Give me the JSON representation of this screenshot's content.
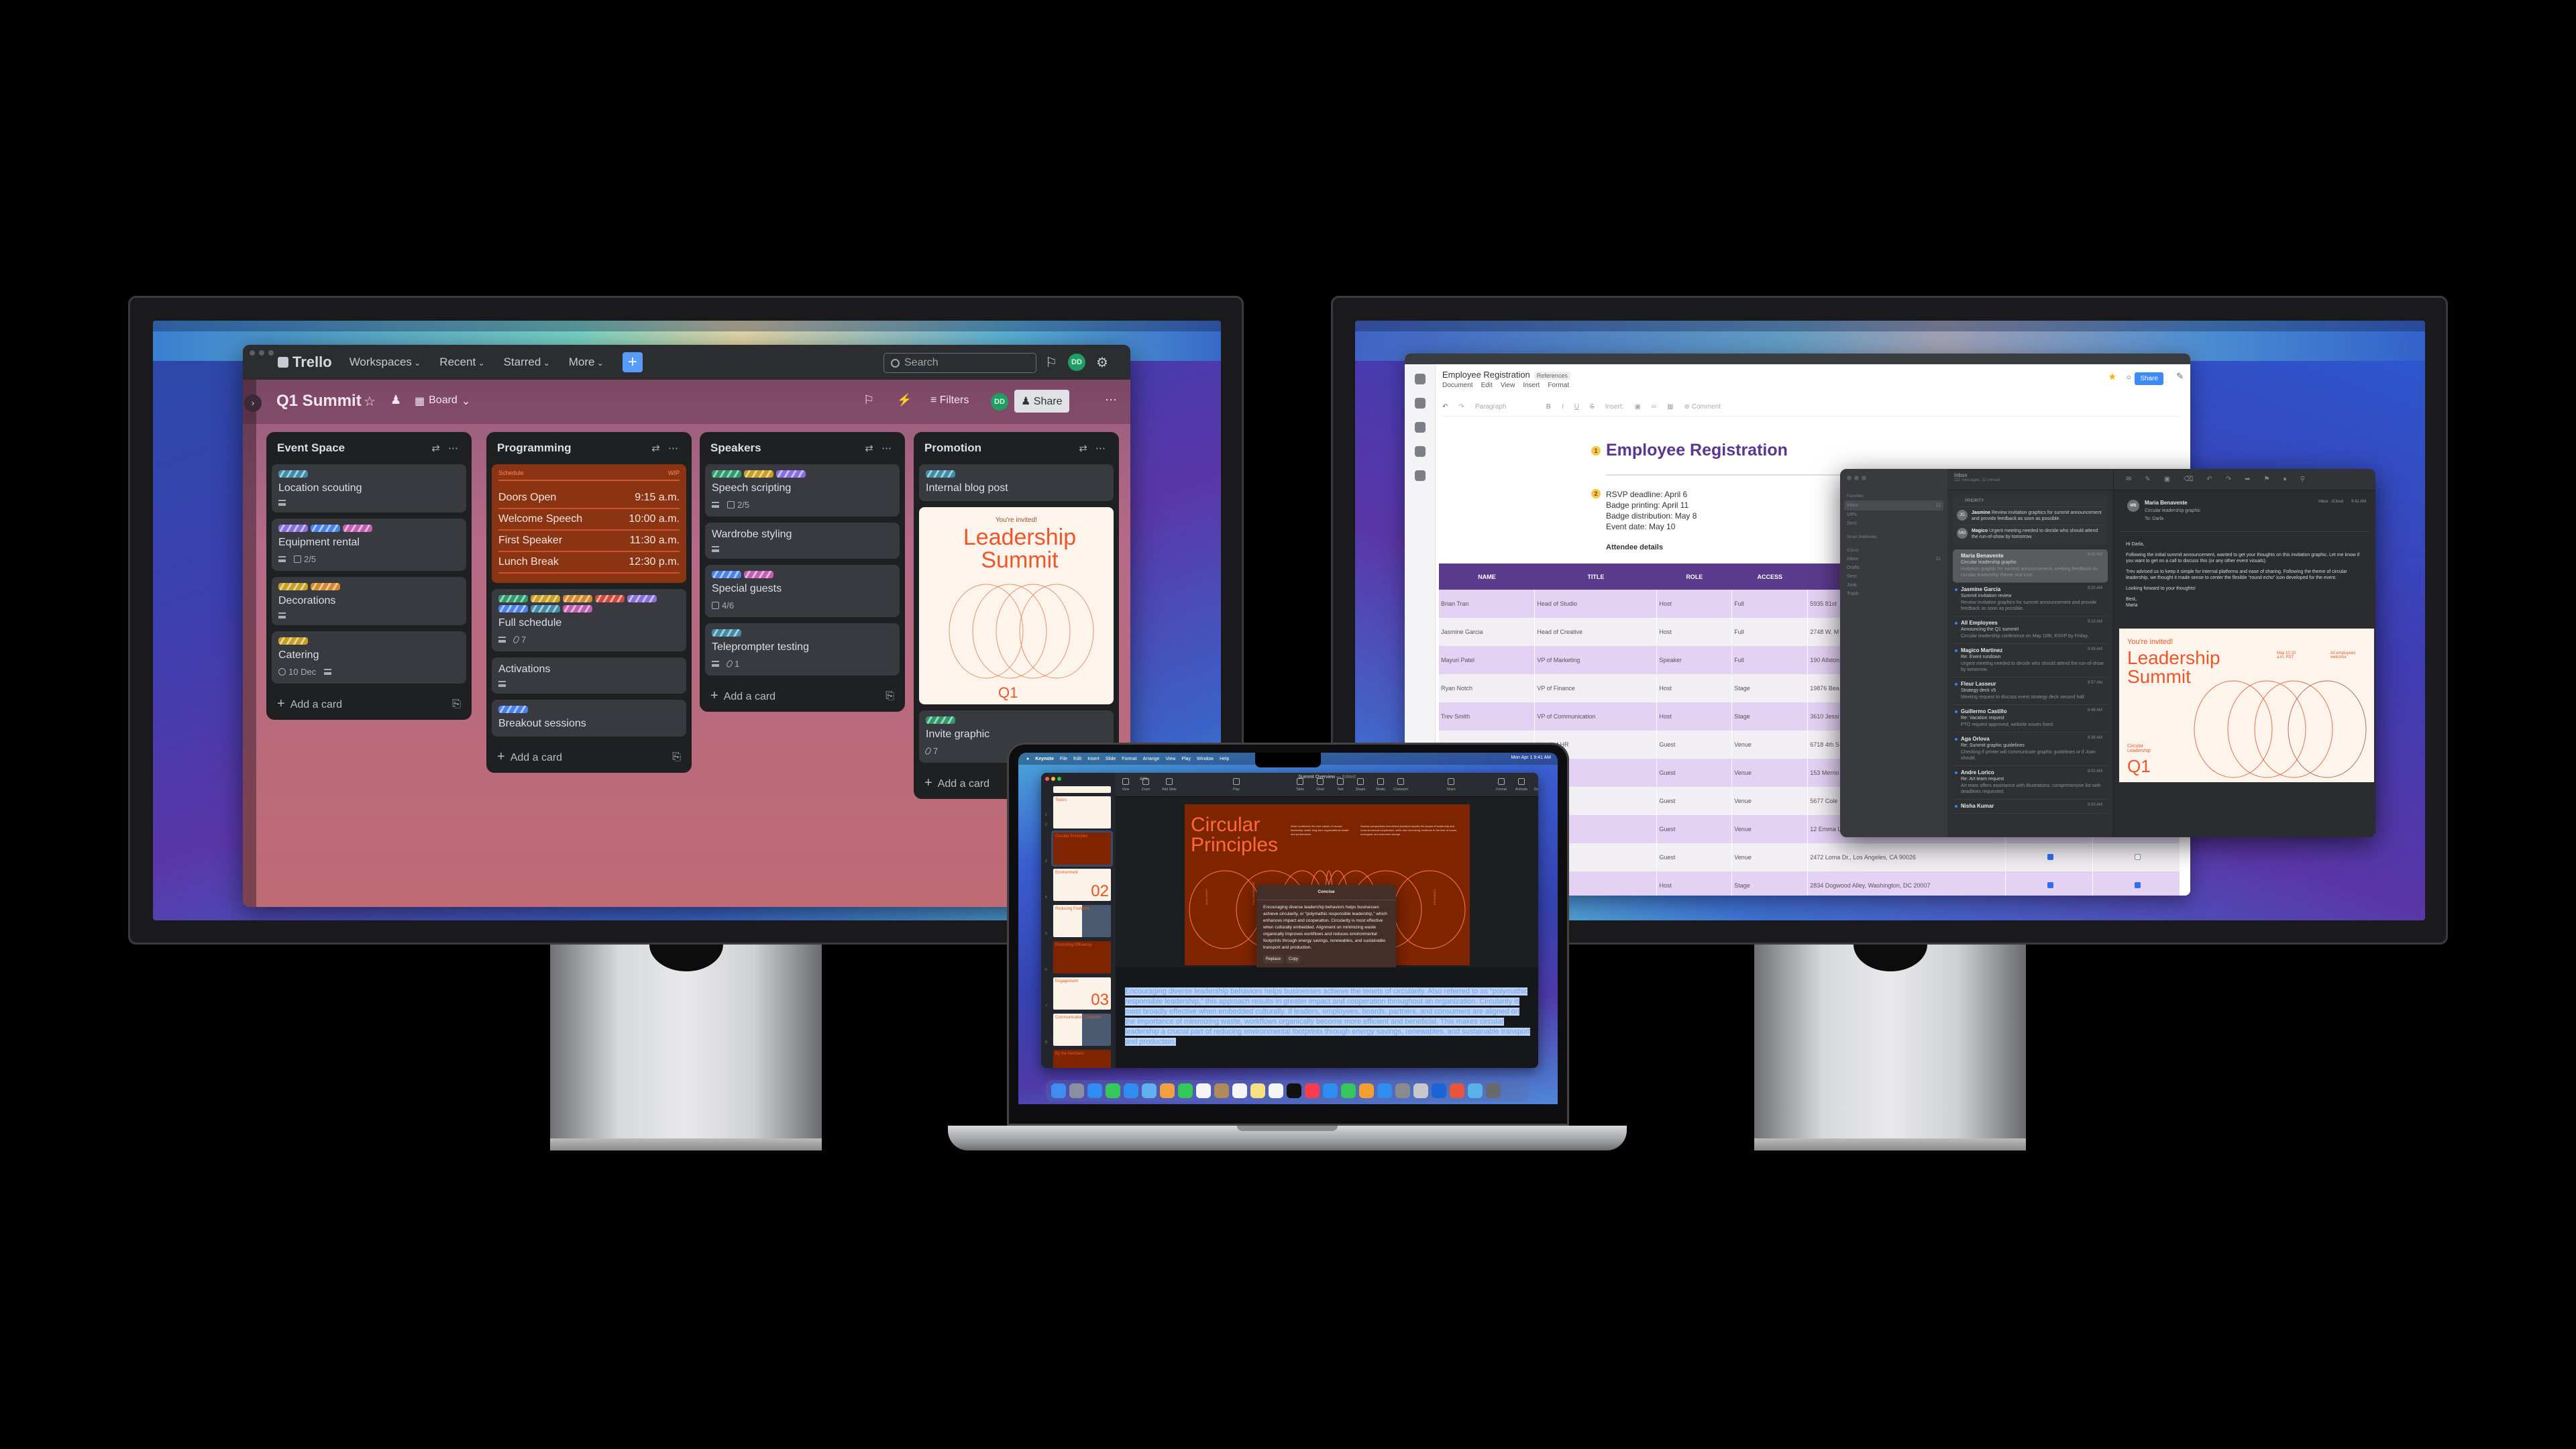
{
  "trello": {
    "logo": "Trello",
    "nav": [
      "Workspaces",
      "Recent",
      "Starred",
      "More"
    ],
    "create_label": "+",
    "search_placeholder": "Search",
    "avatar": "DD",
    "board_title": "Q1 Summit",
    "view_label": "Board",
    "filters_label": "Filters",
    "share_label": "Share",
    "add_card_label": "Add a card",
    "label_colors": {
      "teal": "#3f8ca8",
      "purple": "#8a6ee0",
      "blue": "#4a82ec",
      "pink": "#c05fb2",
      "yellow": "#c8a021",
      "orange": "#d3892b",
      "green": "#2c9a6a",
      "red": "#cf4a3c"
    },
    "lists": [
      {
        "title": "Event Space",
        "cards": [
          {
            "title": "Location scouting",
            "labels": [
              "teal"
            ],
            "badges": [
              {
                "icon": "description"
              }
            ]
          },
          {
            "title": "Equipment rental",
            "labels": [
              "purple",
              "blue",
              "pink"
            ],
            "badges": [
              {
                "icon": "description"
              },
              {
                "icon": "checklist",
                "text": "2/5"
              }
            ]
          },
          {
            "title": "Decorations",
            "labels": [
              "yellow",
              "orange"
            ],
            "badges": [
              {
                "icon": "description"
              }
            ]
          },
          {
            "title": "Catering",
            "labels": [
              "yellow"
            ],
            "badges": [
              {
                "icon": "clock",
                "text": "10 Dec"
              },
              {
                "icon": "description"
              }
            ]
          }
        ]
      },
      {
        "title": "Programming",
        "cards": [
          {
            "type": "schedule",
            "header": "Schedule",
            "tag": "WIP",
            "rows": [
              [
                "Doors Open",
                "9:15 a.m."
              ],
              [
                "Welcome Speech",
                "10:00 a.m."
              ],
              [
                "First Speaker",
                "11:30 a.m."
              ],
              [
                "Lunch Break",
                "12:30 p.m."
              ]
            ]
          },
          {
            "title": "Full schedule",
            "labels": [
              "green",
              "yellow",
              "orange",
              "red",
              "purple",
              "blue",
              "teal",
              "pink"
            ],
            "badges": [
              {
                "icon": "description"
              },
              {
                "icon": "attachment",
                "text": "7"
              }
            ]
          },
          {
            "title": "Activations",
            "labels": [],
            "badges": [
              {
                "icon": "description"
              }
            ]
          },
          {
            "title": "Breakout sessions",
            "labels": [
              "blue"
            ],
            "badges": []
          }
        ]
      },
      {
        "title": "Speakers",
        "cards": [
          {
            "title": "Speech scripting",
            "labels": [
              "green",
              "yellow",
              "purple"
            ],
            "badges": [
              {
                "icon": "description"
              },
              {
                "icon": "checklist",
                "text": "2/5"
              }
            ]
          },
          {
            "title": "Wardrobe styling",
            "labels": [],
            "badges": [
              {
                "icon": "description"
              }
            ]
          },
          {
            "title": "Special guests",
            "labels": [
              "blue",
              "pink"
            ],
            "badges": [
              {
                "icon": "checklist",
                "text": "4/6"
              }
            ]
          },
          {
            "title": "Teleprompter testing",
            "labels": [
              "teal"
            ],
            "badges": [
              {
                "icon": "description"
              },
              {
                "icon": "attachment",
                "text": "1"
              }
            ]
          }
        ]
      },
      {
        "title": "Promotion",
        "cards": [
          {
            "title": "Internal blog post",
            "labels": [
              "teal"
            ],
            "badges": []
          },
          {
            "type": "invite",
            "kicker": "You're invited!",
            "title": "Leadership Summit",
            "footer": "Q1"
          },
          {
            "title": "Invite graphic",
            "labels": [
              "green"
            ],
            "badges": [
              {
                "icon": "attachment",
                "text": "7"
              }
            ]
          }
        ]
      }
    ]
  },
  "doc": {
    "title": "Employee Registration",
    "chip": "References",
    "menu": [
      "Document",
      "Edit",
      "View",
      "Insert",
      "Format"
    ],
    "tools": [
      "Paragraph",
      "Insert:",
      "Comment"
    ],
    "share_label": "Share",
    "heading": "Employee Registration",
    "badge1": "1",
    "badge2": "2",
    "dates": [
      "RSVP deadline: April 6",
      "Badge printing: April 11",
      "Badge distribution: May 8",
      "Event date: May 10"
    ],
    "attendee_label": "Attendee details",
    "columns": [
      "NAME",
      "TITLE",
      "ROLE",
      "ACCESS",
      "",
      "",
      ""
    ],
    "rows": [
      {
        "name": "Brian Tran",
        "title": "Head of Studio",
        "role": "Host",
        "access": "Full",
        "address": "5935 81st"
      },
      {
        "name": "Jasmine Garcia",
        "title": "Head of Creative",
        "role": "Host",
        "access": "Full",
        "address": "2748 W. M"
      },
      {
        "name": "Mayuri Patel",
        "title": "VP of Marketing",
        "role": "Speaker",
        "access": "Full",
        "address": "190 Allston"
      },
      {
        "name": "Ryan Notch",
        "title": "VP of Finance",
        "role": "Host",
        "access": "Stage",
        "address": "19876 Bea"
      },
      {
        "name": "Trev Smith",
        "title": "VP of Communication",
        "role": "Host",
        "access": "Stage",
        "address": "3610 Jessi"
      },
      {
        "name": "",
        "title": "Head of HR",
        "role": "Guest",
        "access": "Venue",
        "address": "6718 4th S"
      },
      {
        "name": "",
        "title": "of Strategy",
        "role": "Guest",
        "access": "Venue",
        "address": "153 Merrio"
      },
      {
        "name": "",
        "title": "of Events",
        "role": "Guest",
        "access": "Venue",
        "address": "5677 Cole"
      },
      {
        "name": "",
        "title": "Strategy",
        "role": "Guest",
        "access": "Venue",
        "address": "12 Emma L"
      },
      {
        "name": "",
        "title": "Director",
        "role": "Guest",
        "access": "Venue",
        "address": "2472 Loma Dr., Los Angeles, CA 90026",
        "c1": true,
        "c2": false
      },
      {
        "name": "",
        "title": "rector",
        "role": "Host",
        "access": "Stage",
        "address": "2834 Dogwood Alley, Washington, DC 20007",
        "c1": true,
        "c2": true
      }
    ]
  },
  "mail": {
    "sidebar": [
      {
        "section": "Favorites"
      },
      {
        "item": "Inbox",
        "count": "11",
        "selected": true
      },
      {
        "item": "VIPs"
      },
      {
        "item": "Sent"
      },
      {
        "section": "Smart Mailboxes"
      },
      {
        "section": "iCloud"
      },
      {
        "item": "Inbox",
        "count": "11"
      },
      {
        "item": "Drafts"
      },
      {
        "item": "Sent"
      },
      {
        "item": "Junk"
      },
      {
        "item": "Trash"
      }
    ],
    "list_title": "Inbox",
    "list_subtitle": "111 messages, 11 unread",
    "priority_label": "PRIORITY",
    "priority": [
      {
        "initials": "JG",
        "sender": "Jasmine",
        "text": "Review invitation graphics for summit announcement and provide feedback as soon as possible."
      },
      {
        "initials": "MM",
        "sender": "Magico",
        "text": "Urgent meeting needed to decide who should attend the run-of-show by tomorrow."
      }
    ],
    "messages": [
      {
        "sender": "Maria Benavente",
        "time": "9:41 AM",
        "subject": "Circular leadership graphic",
        "summary": "Invitation graphic for summit announcement, seeking feedback on circular leadership theme and icon.",
        "selected": true
      },
      {
        "sender": "Jasmine Garcia",
        "time": "9:20 AM",
        "subject": "Summit invitation review",
        "summary": "Review invitation graphics for summit announcement and provide feedback as soon as possible."
      },
      {
        "sender": "All Employees",
        "time": "9:13 AM",
        "subject": "Announcing the Q1 summit!",
        "summary": "Circular leadership conference on May 10th, RSVP by Friday."
      },
      {
        "sender": "Magico Martinez",
        "time": "9:09 AM",
        "subject": "Re: Event rundown",
        "summary": "Urgent meeting needed to decide who should attend the run-of-show by tomorrow."
      },
      {
        "sender": "Fleur Lasseur",
        "time": "8:57 AM",
        "subject": "Strategy deck v5",
        "summary": "Meeting request to discuss event strategy deck second half."
      },
      {
        "sender": "Guillermo Castillo",
        "time": "8:46 AM",
        "subject": "Re: Vacation request",
        "summary": "PTO request approved, website issues fixed."
      },
      {
        "sender": "Aga Orlova",
        "time": "8:38 AM",
        "subject": "Re: Summit graphic guidelines",
        "summary": "Checking if printer will communicate graphic guidelines or if Joan should."
      },
      {
        "sender": "Andre Lorico",
        "time": "8:02 AM",
        "subject": "Re: Art team request",
        "summary": "Art team offers assistance with illustrations; comprehensive list with deadlines requested."
      },
      {
        "sender": "Nisha Kumar",
        "time": "8:00 AM",
        "subject": "",
        "summary": ""
      }
    ],
    "reading": {
      "initials": "MB",
      "from": "Maria Benavente",
      "subject": "Circular leadership graphic",
      "to_label": "To:",
      "to": "Darla",
      "mailbox": "Inbox - iCloud",
      "time": "9:41 AM",
      "body": [
        "Hi Darla,",
        "Following the initial summit announcement, wanted to get your thoughts on this invitation graphic. Let me know if you want to get on a call to discuss this (or any other event visuals).",
        "Trev advised us to keep it simple for internal platforms and ease of sharing. Following the theme of circular leadership, we thought it made sense to center the flexible “round echo” icon developed for the event.",
        "Looking forward to your thoughts!",
        "Best,",
        "Maria"
      ],
      "invite": {
        "kicker": "You're invited!",
        "title": "Leadership Summit",
        "date": "May 10 10 a.m. PDT",
        "audience": "All employees welcome",
        "theme": "Circular Leadership",
        "footer": "Q1"
      }
    }
  },
  "keynote": {
    "menubar": [
      "Keynote",
      "File",
      "Edit",
      "Insert",
      "Slide",
      "Format",
      "Arrange",
      "View",
      "Play",
      "Window",
      "Help"
    ],
    "clock": "Mon Apr 1  9:41 AM",
    "doc_title": "Summit Overview",
    "doc_status": "Edited",
    "zoom": "41%",
    "tools": [
      "View",
      "Zoom",
      "Add Slide",
      "Play",
      "Table",
      "Chart",
      "Text",
      "Shape",
      "Media",
      "Comment",
      "Share",
      "Format",
      "Animate",
      "Document"
    ],
    "thumbs": [
      {
        "n": "1",
        "label": "",
        "style": "cream"
      },
      {
        "n": "2",
        "label": "Topics",
        "style": "cream"
      },
      {
        "n": "3",
        "label": "Circular Principles",
        "style": "dark",
        "selected": true
      },
      {
        "n": "4",
        "label": "Environment",
        "style": "cream",
        "big": "02"
      },
      {
        "n": "5",
        "label": "Reducing Footprint",
        "style": "photo"
      },
      {
        "n": "6",
        "label": "Promoting Efficiency",
        "style": "dark"
      },
      {
        "n": "7",
        "label": "Engagement",
        "style": "cream",
        "big": "03"
      },
      {
        "n": "8",
        "label": "Communication Channels",
        "style": "photo"
      },
      {
        "n": "",
        "label": "By the Numbers",
        "style": "dark"
      }
    ],
    "slide": {
      "title": "Circular Principles",
      "p1": "When combined, the core values of circular leadership center long-term organizational health and performance.",
      "p2": "Diverse perspectives and ethical practices amplify the impact of leadership and cross-functional cooperation, while also increasing resilience in the face of social, ecological, and economic change.",
      "circle_labels": [
        "INCLUSIVITY",
        "COLLABORATION",
        "QUALITY",
        "EFFICIENCY"
      ]
    },
    "popup": {
      "title": "Concise",
      "text": "Encouraging diverse leadership behaviors helps businesses achieve circularity, or “polymathic responsible leadership,” which enhances impact and cooperation. Circularity is most effective when culturally embedded. Alignment on minimizing waste organically improves workflows and reduces environmental footprints through energy savings, renewables, and sustainable transport and production.",
      "replace": "Replace",
      "copy": "Copy"
    },
    "notes": "Encouraging diverse leadership behaviors helps businesses achieve the tenets of circularity. Also referred to as “polymathic responsible leadership,” this approach results in greater impact and cooperation throughout an organization. Circularity is most broadly effective when embedded culturally. If leaders, employees, boards, partners, and consumers are aligned on the importance of minimizing waste, workflows organically become more efficient and beneficial. This makes circular leadership a crucial part of reducing environmental footprints through energy savings, renewables, and sustainable transport and production.",
    "dock": [
      "#3d8ef0",
      "#8a8fa0",
      "#2f8cf0",
      "#34c759",
      "#2f8cf0",
      "#5fb0f0",
      "#f0a040",
      "#34c759",
      "#f5f5f5",
      "#b08a5a",
      "#f5f5f5",
      "#f7e080",
      "#f5f5f5",
      "#111111",
      "#fa3c50",
      "#2f8cf0",
      "#34c759",
      "#f0a030",
      "#2f8cf0",
      "#8a8a8e",
      "#c8c8cc",
      "#1a66d8",
      "#e8553a",
      "#5ab0e8",
      "#6a6a6e"
    ]
  }
}
